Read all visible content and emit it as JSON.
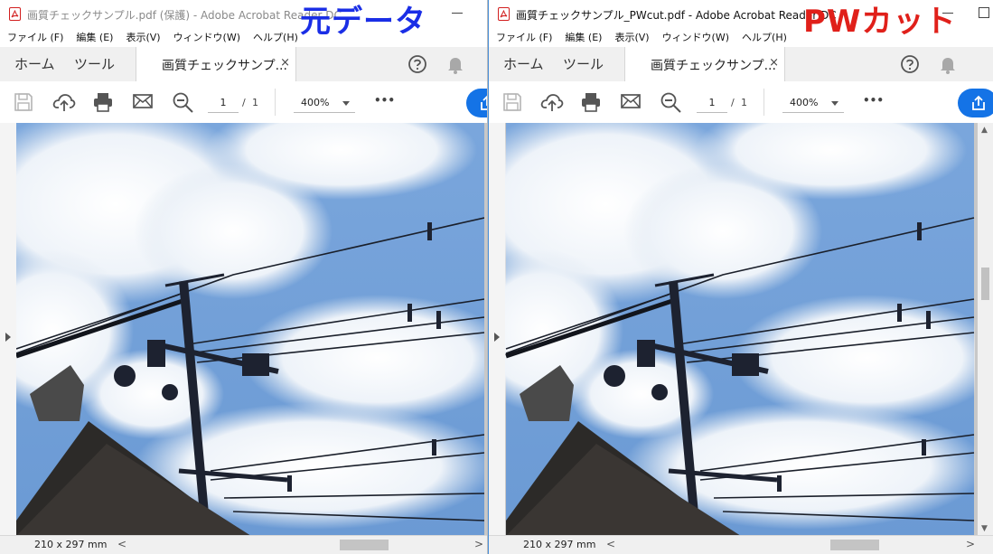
{
  "left": {
    "title": "画質チェックサンプル.pdf (保護) - Adobe Acrobat Reader DC",
    "overlay_label": "元データ",
    "overlay_color": "#1a2ee6"
  },
  "right": {
    "title": "画質チェックサンプル_PWcut.pdf - Adobe Acrobat Reader DC",
    "overlay_label": "PWカット",
    "overlay_color": "#e0201a"
  },
  "menu": [
    "ファイル (F)",
    "編集 (E)",
    "表示(V)",
    "ウィンドウ(W)",
    "ヘルプ(H)"
  ],
  "tabs": {
    "home": "ホーム",
    "tools": "ツール",
    "document": "画質チェックサンプ...",
    "close": "×"
  },
  "toolbar": {
    "page_current": "1",
    "page_sep": "/",
    "page_total": "1",
    "zoom": "400%",
    "more": "•••"
  },
  "status": {
    "page_size": "210 x 297 mm",
    "scroll_left": "<",
    "scroll_right": ">"
  },
  "colors": {
    "acrobat_red": "#d21f1f",
    "share_blue": "#1473e6",
    "sky": "#6f9fd8"
  },
  "icons": [
    "pdf-file-icon",
    "help-icon",
    "bell-icon",
    "save-icon",
    "upload-icon",
    "print-icon",
    "email-icon",
    "zoom-out-icon",
    "share-icon"
  ]
}
